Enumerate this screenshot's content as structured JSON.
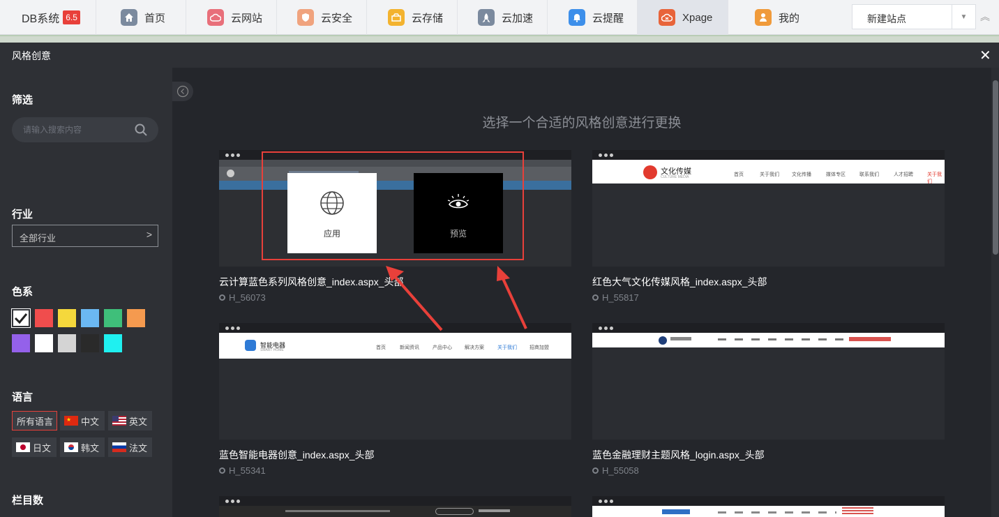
{
  "brand": {
    "name": "DB系统",
    "version": "6.5"
  },
  "nav": [
    {
      "label": "首页",
      "icon": "home-icon",
      "color": "#7b8a9e"
    },
    {
      "label": "云网站",
      "icon": "cloud-icon",
      "color": "#e86f7a"
    },
    {
      "label": "云安全",
      "icon": "shield-icon",
      "color": "#f0a37e"
    },
    {
      "label": "云存储",
      "icon": "storage-icon",
      "color": "#f3b32f"
    },
    {
      "label": "云加速",
      "icon": "rocket-icon",
      "color": "#7b8a9e"
    },
    {
      "label": "云提醒",
      "icon": "bell-icon",
      "color": "#3d8fea"
    },
    {
      "label": "Xpage",
      "icon": "xpage-icon",
      "color": "#e8643a"
    },
    {
      "label": "我的",
      "icon": "user-icon",
      "color": "#f09a3a"
    }
  ],
  "site_select": {
    "label": "新建站点"
  },
  "modal": {
    "title": "风格创意"
  },
  "sidebar": {
    "filter_title": "筛选",
    "search_placeholder": "请输入搜索内容",
    "industry_title": "行业",
    "industry_value": "全部行业",
    "color_title": "色系",
    "colors": [
      "#ffffff",
      "#f04d4d",
      "#f5d83c",
      "#6bb8f2",
      "#3fbf7a",
      "#f59a4f",
      "#9461ea",
      "#ffffff",
      "#d4d4d4",
      "#2a2a2a",
      "#1ff0f0"
    ],
    "language_title": "语言",
    "languages": [
      "所有语言",
      "中文",
      "英文",
      "日文",
      "韩文",
      "法文"
    ],
    "column_title": "栏目数"
  },
  "content": {
    "heading": "选择一个合适的风格创意进行更换",
    "overlay": {
      "apply": "应用",
      "preview": "预览"
    },
    "cards": [
      {
        "name": "云计算蓝色系列风格创意_index.aspx_头部",
        "code": "H_56073"
      },
      {
        "name": "红色大气文化传媒风格_index.aspx_头部",
        "code": "H_55817",
        "logo": "文化传媒",
        "logo_sub": "CULTURE MEDIA"
      },
      {
        "name": "蓝色智能电器创意_index.aspx_头部",
        "code": "H_55341",
        "logo": "智能电器",
        "logo_sub": "SMART HOME",
        "menu": [
          "首页",
          "新闻资讯",
          "产品中心",
          "解决方案",
          "关于我们",
          "招商加盟"
        ]
      },
      {
        "name": "蓝色金融理财主题风格_login.aspx_头部",
        "code": "H_55058"
      }
    ],
    "thumb_menu_2": [
      "首页",
      "关于我们",
      "文化传播",
      "媒体专区",
      "联系我们",
      "人才招聘",
      "关于我们"
    ]
  }
}
